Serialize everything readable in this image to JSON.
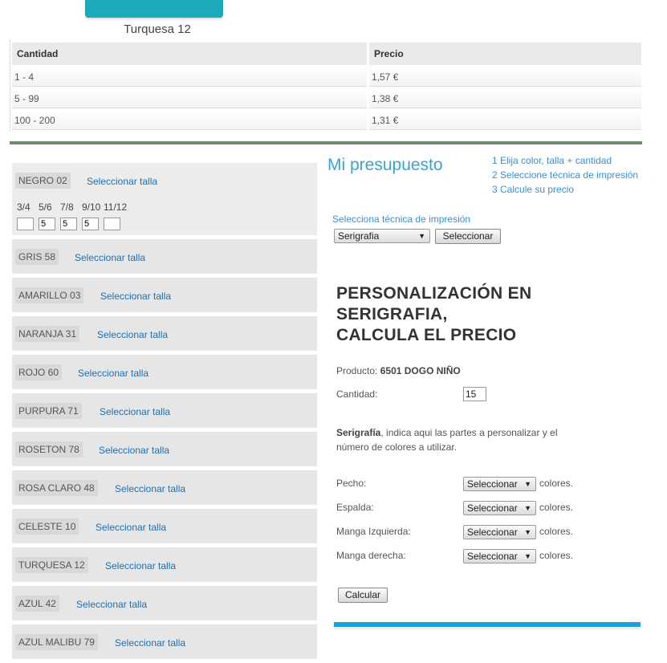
{
  "product_image": {
    "caption": "Turquesa 12",
    "swatch_color": "#1aaab9"
  },
  "price_table": {
    "headers": [
      "Cantidad",
      "Precio"
    ],
    "rows": [
      [
        "1 - 4",
        "1,57 €"
      ],
      [
        "5 - 99",
        "1,38 €"
      ],
      [
        "100 - 200",
        "1,31 €"
      ]
    ]
  },
  "colors": [
    {
      "name": "NEGRO 02",
      "link": "Seleccionar talla"
    },
    {
      "name": "GRIS 58",
      "link": "Seleccionar talla"
    },
    {
      "name": "AMARILLO 03",
      "link": "Seleccionar talla"
    },
    {
      "name": "NARANJA 31",
      "link": "Seleccionar talla"
    },
    {
      "name": "ROJO 60",
      "link": "Seleccionar talla"
    },
    {
      "name": "PURPURA 71",
      "link": "Seleccionar talla"
    },
    {
      "name": "ROSETON 78",
      "link": "Seleccionar talla"
    },
    {
      "name": "ROSA CLARO 48",
      "link": "Seleccionar talla"
    },
    {
      "name": "CELESTE 10",
      "link": "Seleccionar talla"
    },
    {
      "name": "TURQUESA 12",
      "link": "Seleccionar talla"
    },
    {
      "name": "AZUL 42",
      "link": "Seleccionar talla"
    },
    {
      "name": "AZUL MALIBU 79",
      "link": "Seleccionar talla"
    }
  ],
  "sizes": [
    {
      "label": "3/4",
      "value": ""
    },
    {
      "label": "5/6",
      "value": "5"
    },
    {
      "label": "7/8",
      "value": "5"
    },
    {
      "label": "9/10",
      "value": "5"
    },
    {
      "label": "11/12",
      "value": ""
    }
  ],
  "budget": {
    "title": "Mi presupuesto",
    "steps": [
      "1 Elija color, talla + cantidad",
      "2 Seleccione técnica de impresión",
      "3 Calcule su precio"
    ],
    "technique_label": "Selecciona técnica de impresión",
    "technique_value": "Serigrafia",
    "select_button": "Seleccionar"
  },
  "personalization": {
    "title_lines": [
      "PERSONALIZACIÓN EN",
      "SERIGRAFIA,",
      "CALCULA EL PRECIO"
    ],
    "product_label": "Producto:",
    "product_value": "6501 DOGO NIÑO",
    "quantity_label": "Cantidad:",
    "quantity_value": "15",
    "desc_bold": "Serigrafía",
    "desc_rest": ", indica aqui las partes a personalizar y el número de colores a utilizar.",
    "parts": [
      {
        "label": "Pecho:",
        "select": "Seleccionar",
        "suffix": "colores."
      },
      {
        "label": "Espalda:",
        "select": "Seleccionar",
        "suffix": "colores."
      },
      {
        "label": "Manga Izquierda:",
        "select": "Seleccionar",
        "suffix": "colores."
      },
      {
        "label": "Manga derecha:",
        "select": "Seleccionar",
        "suffix": "colores."
      }
    ],
    "calc_button": "Calcular"
  },
  "accent_colors": {
    "link": "#1a6fb5",
    "title_blue": "#3ba3d4",
    "rule_green": "#6f8a6f",
    "bar_blue": "#1aa0dc"
  }
}
